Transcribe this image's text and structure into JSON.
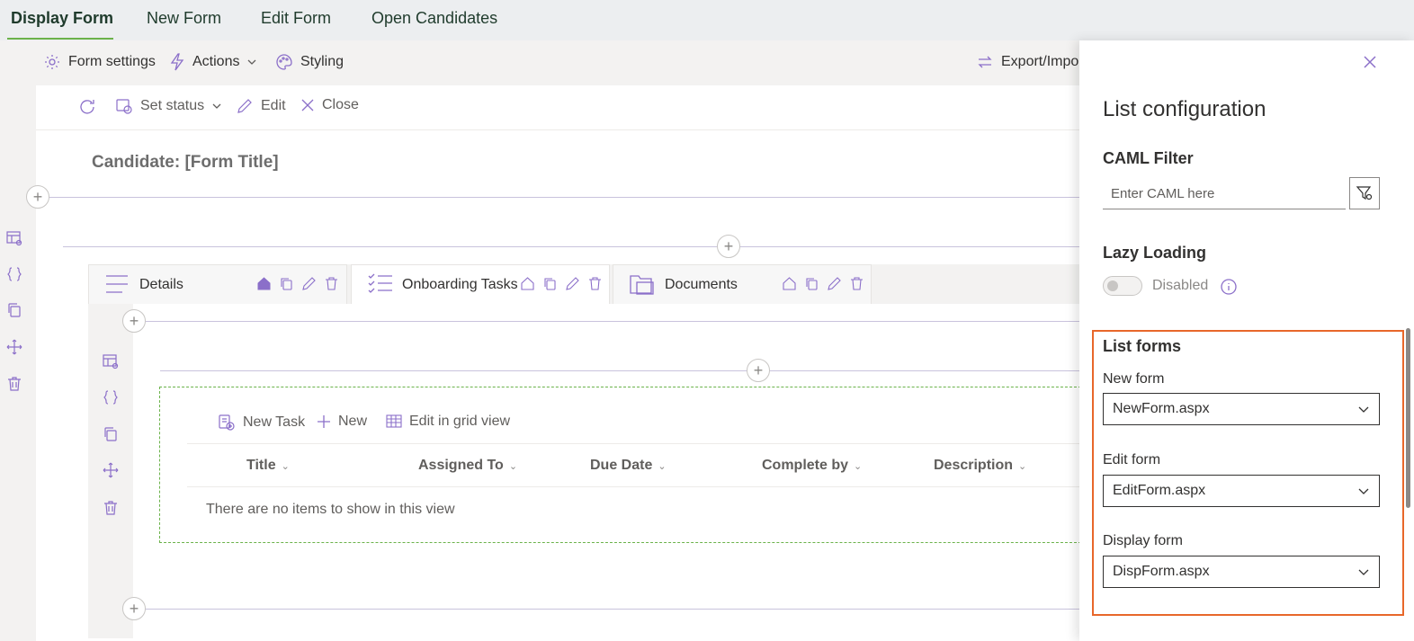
{
  "top_tabs": {
    "display_form": "Display Form",
    "new_form": "New Form",
    "edit_form": "Edit Form",
    "open_candidates": "Open Candidates"
  },
  "toolbar": {
    "form_settings": "Form settings",
    "actions": "Actions",
    "styling": "Styling",
    "export_import": "Export/Impo"
  },
  "command_bar": {
    "set_status": "Set status",
    "edit": "Edit",
    "close": "Close"
  },
  "form_title": "Candidate: [Form Title]",
  "section_tabs": {
    "details": "Details",
    "onboarding_tasks": "Onboarding Tasks",
    "documents": "Documents"
  },
  "list": {
    "new_task": "New Task",
    "new": "New",
    "edit_grid": "Edit in grid view",
    "columns": [
      "Title",
      "Assigned To",
      "Due Date",
      "Complete by",
      "Description"
    ],
    "empty_message": "There are no items to show in this view"
  },
  "panel": {
    "title": "List configuration",
    "caml_filter_heading": "CAML Filter",
    "caml_placeholder": "Enter CAML here",
    "lazy_loading_heading": "Lazy Loading",
    "lazy_loading_state": "Disabled",
    "list_forms_heading": "List forms",
    "new_form_label": "New form",
    "new_form_value": "NewForm.aspx",
    "edit_form_label": "Edit form",
    "edit_form_value": "EditForm.aspx",
    "display_form_label": "Display form",
    "display_form_value": "DispForm.aspx"
  },
  "colors": {
    "accent_purple": "#8b6fc9",
    "active_tab_green": "#6bb24a",
    "highlight_orange": "#e8672a"
  }
}
